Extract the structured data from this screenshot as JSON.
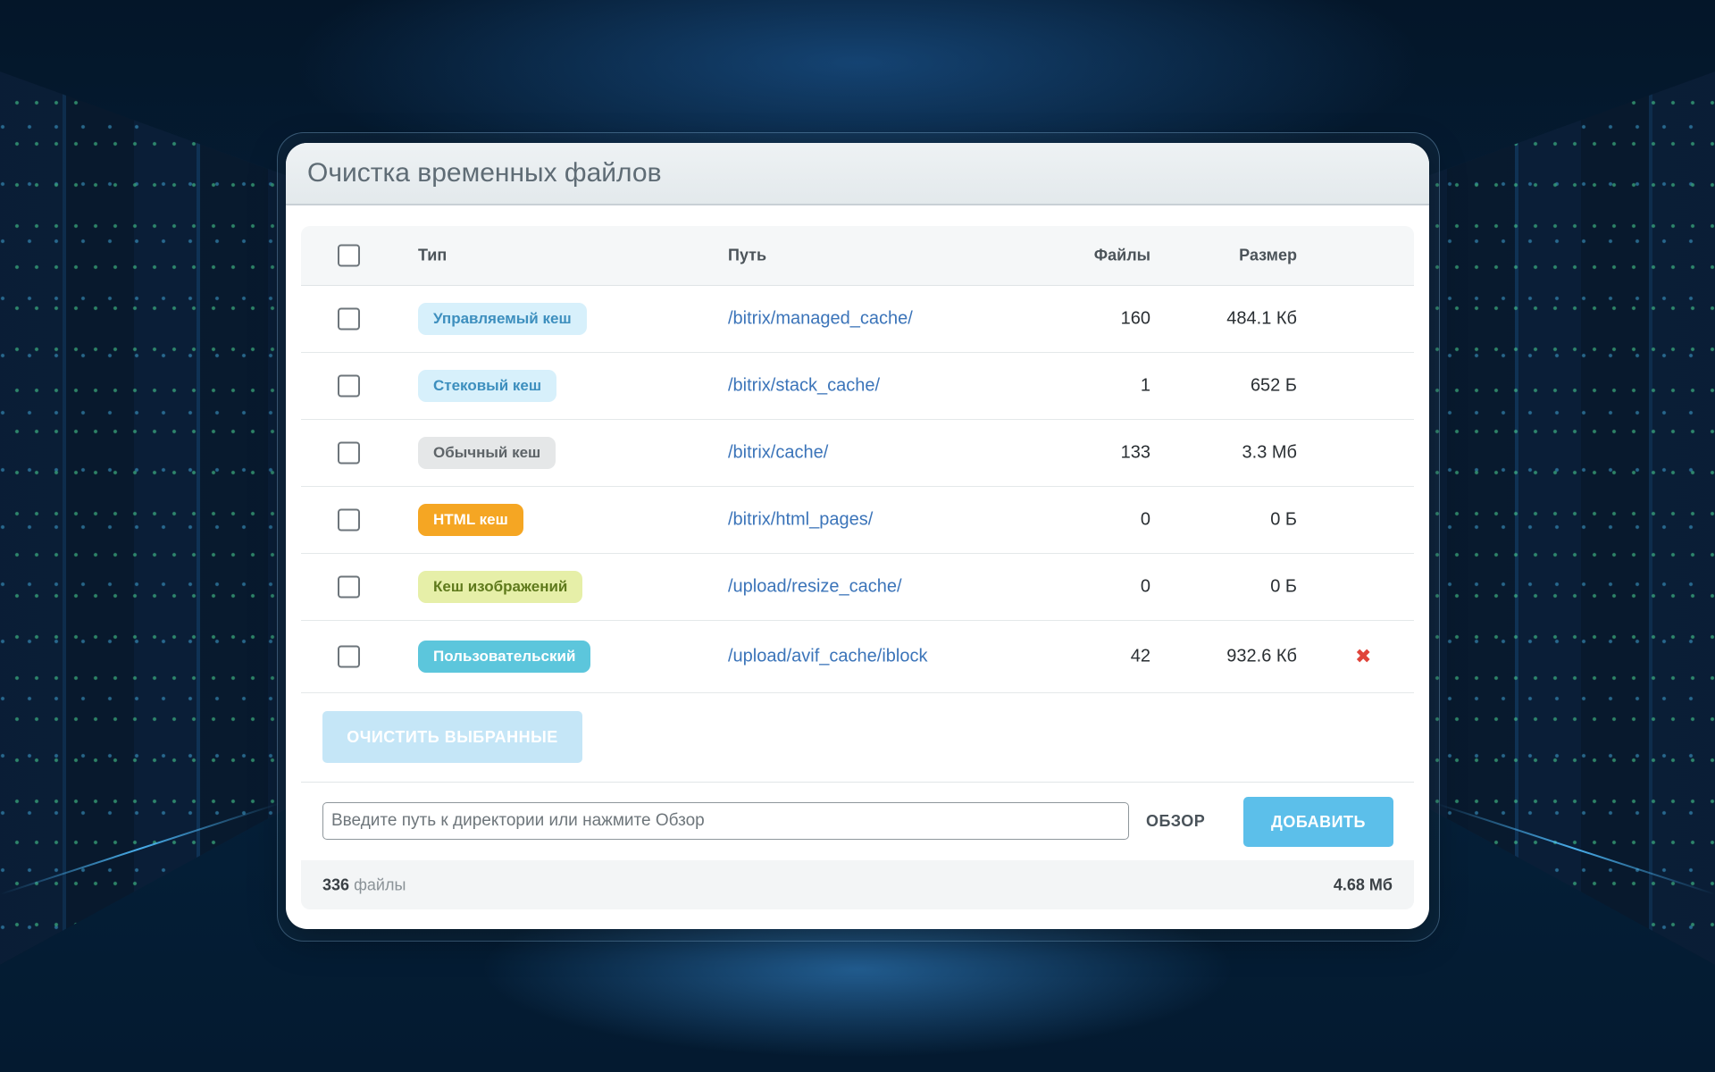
{
  "window": {
    "title": "Очистка временных файлов"
  },
  "table": {
    "headers": {
      "type": "Тип",
      "path": "Путь",
      "files": "Файлы",
      "size": "Размер"
    },
    "rows": [
      {
        "type": "Управляемый кеш",
        "path": "/bitrix/managed_cache/",
        "files": "160",
        "size": "484.1 Кб",
        "badge_color": "#d7f0fb"
      },
      {
        "type": "Стековый кеш",
        "path": "/bitrix/stack_cache/",
        "files": "1",
        "size": "652 Б",
        "badge_color": "#d7f0fb"
      },
      {
        "type": "Обычный кеш",
        "path": "/bitrix/cache/",
        "files": "133",
        "size": "3.3 Мб",
        "badge_color": "#e5e7e8"
      },
      {
        "type": "HTML кеш",
        "path": "/bitrix/html_pages/",
        "files": "0",
        "size": "0 Б",
        "badge_color": "#f5a623"
      },
      {
        "type": "Кеш изображений",
        "path": "/upload/resize_cache/",
        "files": "0",
        "size": "0 Б",
        "badge_color": "#e6efa8"
      },
      {
        "type": "Пользовательский",
        "path": "/upload/avif_cache/iblock",
        "files": "42",
        "size": "932.6 Кб",
        "badge_color": "#5cc6dc",
        "delete_icon": "close-icon"
      }
    ]
  },
  "actions": {
    "clear_selected": "ОЧИСТИТЬ ВЫБРАННЫЕ",
    "browse": "ОБЗОР",
    "add": "ДОБАВИТЬ"
  },
  "path_input": {
    "placeholder": "Введите путь к директории или нажмите Обзор",
    "value": ""
  },
  "footer": {
    "files_count": "336",
    "files_label": "файлы",
    "total_size": "4.68 Мб"
  },
  "colors": {
    "accent": "#5cbfea",
    "link": "#3b74b9",
    "delete": "#e0443a"
  }
}
